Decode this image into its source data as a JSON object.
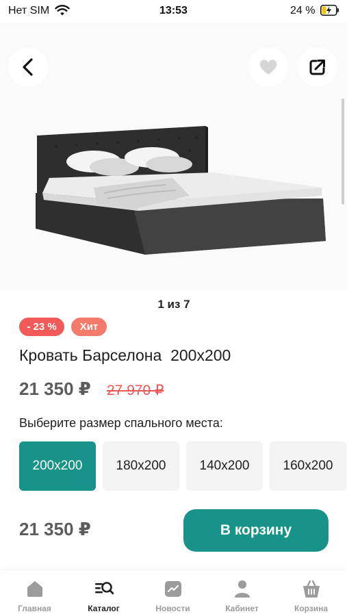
{
  "status_bar": {
    "carrier": "Нет SIM",
    "time": "13:53",
    "battery": "24 %"
  },
  "gallery": {
    "counter": "1 из 7"
  },
  "badges": {
    "discount": "- 23 %",
    "hit": "Хит"
  },
  "product": {
    "title": "Кровать Барселона  200x200",
    "price": "21 350 ₽",
    "old_price": "27 970 ₽"
  },
  "size_selector": {
    "label": "Выберите размер спального места:",
    "options": [
      "200x200",
      "180x200",
      "140x200",
      "160x200"
    ],
    "selected_index": 0
  },
  "purchase": {
    "price": "21 350 ₽",
    "cart_button": "В корзину"
  },
  "tab_bar": {
    "tabs": [
      {
        "label": "Главная",
        "icon": "home-icon"
      },
      {
        "label": "Каталог",
        "icon": "catalog-search-icon"
      },
      {
        "label": "Новости",
        "icon": "news-icon"
      },
      {
        "label": "Кабинет",
        "icon": "user-icon"
      },
      {
        "label": "Корзина",
        "icon": "basket-icon"
      }
    ],
    "active_index": 1
  },
  "colors": {
    "accent": "#17938a",
    "discount_badge": "#f25a5a",
    "hit_badge": "#f47a6c",
    "old_price": "#f05555"
  }
}
